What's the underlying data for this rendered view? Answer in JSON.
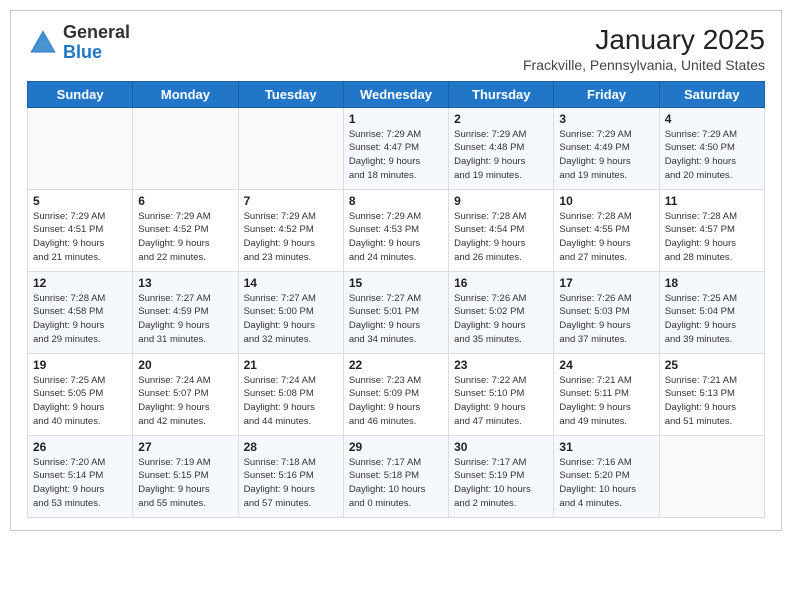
{
  "header": {
    "logo_line1": "General",
    "logo_line2": "Blue",
    "calendar_title": "January 2025",
    "calendar_subtitle": "Frackville, Pennsylvania, United States"
  },
  "days_of_week": [
    "Sunday",
    "Monday",
    "Tuesday",
    "Wednesday",
    "Thursday",
    "Friday",
    "Saturday"
  ],
  "weeks": [
    [
      {
        "day": "",
        "info": ""
      },
      {
        "day": "",
        "info": ""
      },
      {
        "day": "",
        "info": ""
      },
      {
        "day": "1",
        "info": "Sunrise: 7:29 AM\nSunset: 4:47 PM\nDaylight: 9 hours\nand 18 minutes."
      },
      {
        "day": "2",
        "info": "Sunrise: 7:29 AM\nSunset: 4:48 PM\nDaylight: 9 hours\nand 19 minutes."
      },
      {
        "day": "3",
        "info": "Sunrise: 7:29 AM\nSunset: 4:49 PM\nDaylight: 9 hours\nand 19 minutes."
      },
      {
        "day": "4",
        "info": "Sunrise: 7:29 AM\nSunset: 4:50 PM\nDaylight: 9 hours\nand 20 minutes."
      }
    ],
    [
      {
        "day": "5",
        "info": "Sunrise: 7:29 AM\nSunset: 4:51 PM\nDaylight: 9 hours\nand 21 minutes."
      },
      {
        "day": "6",
        "info": "Sunrise: 7:29 AM\nSunset: 4:52 PM\nDaylight: 9 hours\nand 22 minutes."
      },
      {
        "day": "7",
        "info": "Sunrise: 7:29 AM\nSunset: 4:52 PM\nDaylight: 9 hours\nand 23 minutes."
      },
      {
        "day": "8",
        "info": "Sunrise: 7:29 AM\nSunset: 4:53 PM\nDaylight: 9 hours\nand 24 minutes."
      },
      {
        "day": "9",
        "info": "Sunrise: 7:28 AM\nSunset: 4:54 PM\nDaylight: 9 hours\nand 26 minutes."
      },
      {
        "day": "10",
        "info": "Sunrise: 7:28 AM\nSunset: 4:55 PM\nDaylight: 9 hours\nand 27 minutes."
      },
      {
        "day": "11",
        "info": "Sunrise: 7:28 AM\nSunset: 4:57 PM\nDaylight: 9 hours\nand 28 minutes."
      }
    ],
    [
      {
        "day": "12",
        "info": "Sunrise: 7:28 AM\nSunset: 4:58 PM\nDaylight: 9 hours\nand 29 minutes."
      },
      {
        "day": "13",
        "info": "Sunrise: 7:27 AM\nSunset: 4:59 PM\nDaylight: 9 hours\nand 31 minutes."
      },
      {
        "day": "14",
        "info": "Sunrise: 7:27 AM\nSunset: 5:00 PM\nDaylight: 9 hours\nand 32 minutes."
      },
      {
        "day": "15",
        "info": "Sunrise: 7:27 AM\nSunset: 5:01 PM\nDaylight: 9 hours\nand 34 minutes."
      },
      {
        "day": "16",
        "info": "Sunrise: 7:26 AM\nSunset: 5:02 PM\nDaylight: 9 hours\nand 35 minutes."
      },
      {
        "day": "17",
        "info": "Sunrise: 7:26 AM\nSunset: 5:03 PM\nDaylight: 9 hours\nand 37 minutes."
      },
      {
        "day": "18",
        "info": "Sunrise: 7:25 AM\nSunset: 5:04 PM\nDaylight: 9 hours\nand 39 minutes."
      }
    ],
    [
      {
        "day": "19",
        "info": "Sunrise: 7:25 AM\nSunset: 5:05 PM\nDaylight: 9 hours\nand 40 minutes."
      },
      {
        "day": "20",
        "info": "Sunrise: 7:24 AM\nSunset: 5:07 PM\nDaylight: 9 hours\nand 42 minutes."
      },
      {
        "day": "21",
        "info": "Sunrise: 7:24 AM\nSunset: 5:08 PM\nDaylight: 9 hours\nand 44 minutes."
      },
      {
        "day": "22",
        "info": "Sunrise: 7:23 AM\nSunset: 5:09 PM\nDaylight: 9 hours\nand 46 minutes."
      },
      {
        "day": "23",
        "info": "Sunrise: 7:22 AM\nSunset: 5:10 PM\nDaylight: 9 hours\nand 47 minutes."
      },
      {
        "day": "24",
        "info": "Sunrise: 7:21 AM\nSunset: 5:11 PM\nDaylight: 9 hours\nand 49 minutes."
      },
      {
        "day": "25",
        "info": "Sunrise: 7:21 AM\nSunset: 5:13 PM\nDaylight: 9 hours\nand 51 minutes."
      }
    ],
    [
      {
        "day": "26",
        "info": "Sunrise: 7:20 AM\nSunset: 5:14 PM\nDaylight: 9 hours\nand 53 minutes."
      },
      {
        "day": "27",
        "info": "Sunrise: 7:19 AM\nSunset: 5:15 PM\nDaylight: 9 hours\nand 55 minutes."
      },
      {
        "day": "28",
        "info": "Sunrise: 7:18 AM\nSunset: 5:16 PM\nDaylight: 9 hours\nand 57 minutes."
      },
      {
        "day": "29",
        "info": "Sunrise: 7:17 AM\nSunset: 5:18 PM\nDaylight: 10 hours\nand 0 minutes."
      },
      {
        "day": "30",
        "info": "Sunrise: 7:17 AM\nSunset: 5:19 PM\nDaylight: 10 hours\nand 2 minutes."
      },
      {
        "day": "31",
        "info": "Sunrise: 7:16 AM\nSunset: 5:20 PM\nDaylight: 10 hours\nand 4 minutes."
      },
      {
        "day": "",
        "info": ""
      }
    ]
  ]
}
